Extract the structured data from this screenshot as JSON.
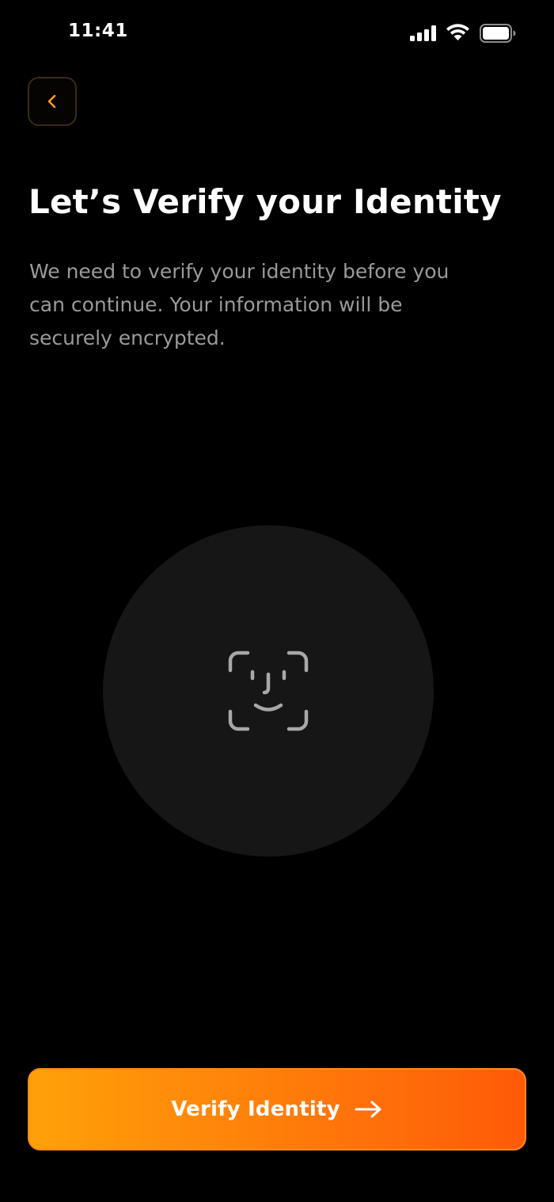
{
  "status_bar": {
    "time": "11:41",
    "icons": [
      "signal-icon",
      "wifi-icon",
      "battery-icon"
    ]
  },
  "header": {
    "back_icon": "chevron-left-icon"
  },
  "main": {
    "title": "Let’s Verify your Identity",
    "description": "We need to verify your identity before you can continue. Your information will be securely encrypted.",
    "illustration_icon": "face-id-icon"
  },
  "footer": {
    "verify_button_label": "Verify Identity",
    "verify_button_icon": "arrow-right-icon"
  },
  "colors": {
    "background": "#000000",
    "accent_start": "#ffa109",
    "accent_end": "#ff5a08",
    "back_chevron": "#ff9a1a",
    "description_text": "#9a9a9a",
    "circle_fill": "#161616",
    "face_icon": "#a8a8a8"
  }
}
